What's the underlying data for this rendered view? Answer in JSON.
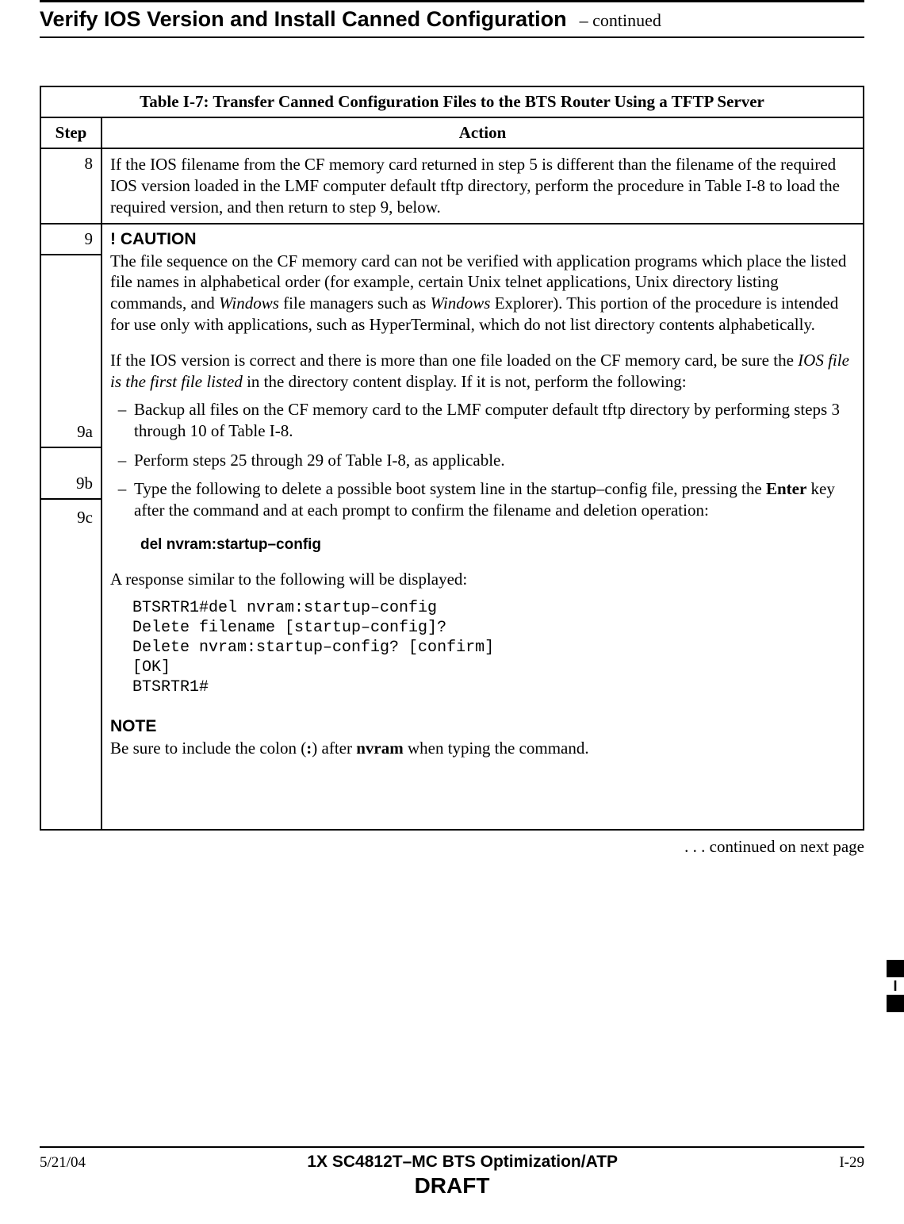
{
  "header": {
    "title": "Verify IOS Version and Install Canned Configuration",
    "continued": "– continued"
  },
  "table": {
    "caption_num": "Table I-7:",
    "caption_txt": "Transfer Canned Configuration Files to the BTS Router Using a TFTP Server",
    "head_step": "Step",
    "head_action": "Action"
  },
  "row8": {
    "step": "8",
    "text": "If the IOS filename from the CF memory card returned in step 5 is different than the filename of the required IOS version loaded in the LMF computer default tftp directory, perform the procedure in Table I-8 to load the required version, and then return to step 9, below."
  },
  "row9": {
    "step": "9",
    "caution": "! CAUTION",
    "caution_p1a": "The file sequence on the CF memory card can not be verified with application programs which place the listed file names in alphabetical order (for example, certain Unix telnet applications, Unix directory listing commands, and ",
    "caution_windows1": "Windows",
    "caution_p1b": " file managers such as ",
    "caution_windows2": "Windows",
    "caution_p1c": " Explorer). This portion of the procedure is intended for use only with applications, such as HyperTerminal, which do not list directory contents alphabetically.",
    "p2a": "If the IOS version is correct and there is more than one file loaded on the CF memory card, be sure the ",
    "p2i": "IOS file is the first file listed",
    "p2b": " in the directory content display. If it is not, perform the following:",
    "s9a": "9a",
    "s9a_txt": "Backup all files on the CF memory card to the LMF computer default tftp directory by performing steps 3 through 10 of Table I-8.",
    "s9b": "9b",
    "s9b_txt": "Perform steps 25 through 29 of Table I-8, as applicable.",
    "s9c": "9c",
    "s9c_txt_a": "Type the following to delete a possible boot system line in the startup–config file, pressing the ",
    "s9c_enter": "Enter",
    "s9c_txt_b": " key after the command and at each prompt to confirm the filename and deletion operation:",
    "cmd": "del  nvram:startup–config",
    "resp_intro": "A response similar to the following will be displayed:",
    "mono": "BTSRTR1#del nvram:startup–config\nDelete filename [startup–config]?\nDelete nvram:startup–config? [confirm]\n[OK]\nBTSRTR1#",
    "note": "NOTE",
    "note_a": "Be sure to include the colon (",
    "note_colon": ":",
    "note_b": ") after ",
    "note_nvram": "nvram",
    "note_c": " when typing the command."
  },
  "cont_next": ". . . continued on next page",
  "side_tab": "I",
  "footer": {
    "date": "5/21/04",
    "center": "1X SC4812T–MC BTS Optimization/ATP",
    "page": "I-29",
    "draft": "DRAFT"
  }
}
